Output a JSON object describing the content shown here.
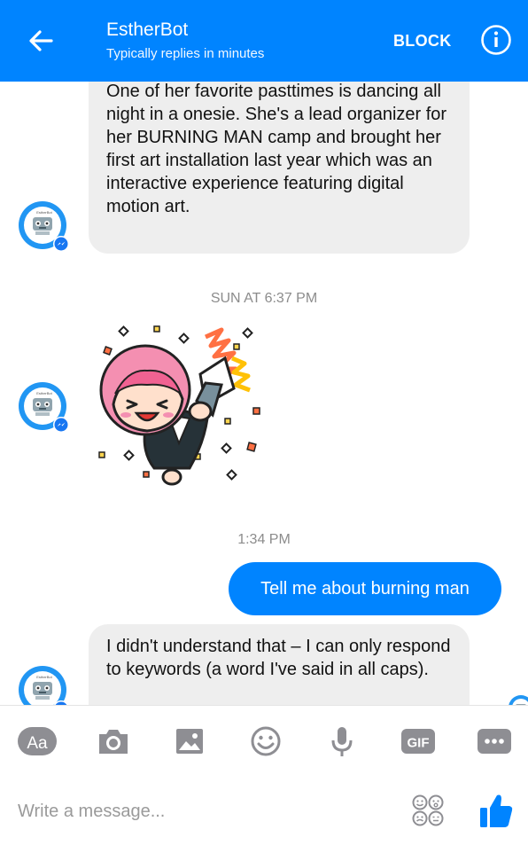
{
  "header": {
    "title": "EstherBot",
    "subtitle": "Typically replies in minutes",
    "block_label": "BLOCK",
    "icons": {
      "back": "back-arrow-icon",
      "info": "info-icon"
    }
  },
  "messages": {
    "bot_message_1": "One of her favorite pasttimes is dancing all night in a onesie.     She's a lead organizer for her BURNING MAN camp and brought her first art installation last year which was an interactive experience featuring digital motion art.",
    "timestamp_1": "SUN AT 6:37 PM",
    "timestamp_2": "1:34 PM",
    "user_message": "Tell me about burning man",
    "bot_message_2": "I didn't understand that – I can only respond to keywords (a word I've said in all caps).",
    "avatar_label": "EstherBot"
  },
  "toolbar": {
    "text_label": "Aa",
    "gif_label": "GIF",
    "icons": [
      "text-icon",
      "camera-icon",
      "image-icon",
      "emoji-icon",
      "microphone-icon",
      "gif-icon",
      "more-icon"
    ]
  },
  "composer": {
    "placeholder": "Write a message...",
    "icons": [
      "reactions-icon",
      "thumbs-up-icon"
    ]
  },
  "colors": {
    "accent": "#0084ff",
    "bubble_in": "#eeeeee",
    "timestamp": "#8c8c8c"
  }
}
